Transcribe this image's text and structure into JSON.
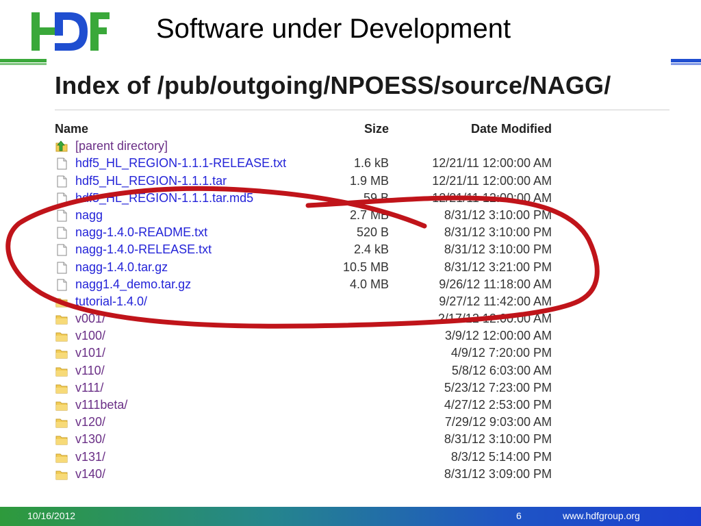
{
  "slide": {
    "title": "Software under Development",
    "logo_text": "HDF"
  },
  "listing": {
    "heading": "Index of /pub/outgoing/NPOESS/source/NAGG/",
    "columns": {
      "name": "Name",
      "size": "Size",
      "date": "Date Modified"
    },
    "rows": [
      {
        "name": "[parent directory]",
        "size": "",
        "date": "",
        "icon": "parent-directory-icon",
        "visited": true
      },
      {
        "name": "hdf5_HL_REGION-1.1.1-RELEASE.txt",
        "size": "1.6 kB",
        "date": "12/21/11 12:00:00 AM",
        "icon": "file-icon",
        "visited": false
      },
      {
        "name": "hdf5_HL_REGION-1.1.1.tar",
        "size": "1.9 MB",
        "date": "12/21/11 12:00:00 AM",
        "icon": "file-icon",
        "visited": false
      },
      {
        "name": "hdf5_HL_REGION-1.1.1.tar.md5",
        "size": "59 B",
        "date": "12/21/11 12:00:00 AM",
        "icon": "file-icon",
        "visited": false
      },
      {
        "name": "nagg",
        "size": "2.7 MB",
        "date": "8/31/12 3:10:00 PM",
        "icon": "file-icon",
        "visited": false
      },
      {
        "name": "nagg-1.4.0-README.txt",
        "size": "520 B",
        "date": "8/31/12 3:10:00 PM",
        "icon": "file-icon",
        "visited": false
      },
      {
        "name": "nagg-1.4.0-RELEASE.txt",
        "size": "2.4 kB",
        "date": "8/31/12 3:10:00 PM",
        "icon": "file-icon",
        "visited": false
      },
      {
        "name": "nagg-1.4.0.tar.gz",
        "size": "10.5 MB",
        "date": "8/31/12 3:21:00 PM",
        "icon": "file-icon",
        "visited": false
      },
      {
        "name": "nagg1.4_demo.tar.gz",
        "size": "4.0 MB",
        "date": "9/26/12 11:18:00 AM",
        "icon": "file-icon",
        "visited": false
      },
      {
        "name": "tutorial-1.4.0/",
        "size": "",
        "date": "9/27/12 11:42:00 AM",
        "icon": "folder-icon",
        "visited": false
      },
      {
        "name": "v001/",
        "size": "",
        "date": "2/17/12 12:00:00 AM",
        "icon": "folder-icon",
        "visited": true
      },
      {
        "name": "v100/",
        "size": "",
        "date": "3/9/12 12:00:00 AM",
        "icon": "folder-icon",
        "visited": true
      },
      {
        "name": "v101/",
        "size": "",
        "date": "4/9/12 7:20:00 PM",
        "icon": "folder-icon",
        "visited": true
      },
      {
        "name": "v110/",
        "size": "",
        "date": "5/8/12 6:03:00 AM",
        "icon": "folder-icon",
        "visited": true
      },
      {
        "name": "v111/",
        "size": "",
        "date": "5/23/12 7:23:00 PM",
        "icon": "folder-icon",
        "visited": true
      },
      {
        "name": "v111beta/",
        "size": "",
        "date": "4/27/12 2:53:00 PM",
        "icon": "folder-icon",
        "visited": true
      },
      {
        "name": "v120/",
        "size": "",
        "date": "7/29/12 9:03:00 AM",
        "icon": "folder-icon",
        "visited": true
      },
      {
        "name": "v130/",
        "size": "",
        "date": "8/31/12 3:10:00 PM",
        "icon": "folder-icon",
        "visited": true
      },
      {
        "name": "v131/",
        "size": "",
        "date": "8/3/12 5:14:00 PM",
        "icon": "folder-icon",
        "visited": true
      },
      {
        "name": "v140/",
        "size": "",
        "date": "8/31/12 3:09:00 PM",
        "icon": "folder-icon",
        "visited": true
      }
    ]
  },
  "annotation": {
    "color": "#c0141a",
    "shape": "hand-drawn-ellipse-with-arrow"
  },
  "footer": {
    "date": "10/16/2012",
    "page": "6",
    "url": "www.hdfgroup.org"
  },
  "colors": {
    "link": "#2323d8",
    "visited_link": "#6a2f86",
    "logo_green": "#3aa83a",
    "logo_blue": "#1f4ed0",
    "annotation_red": "#c0141a"
  }
}
